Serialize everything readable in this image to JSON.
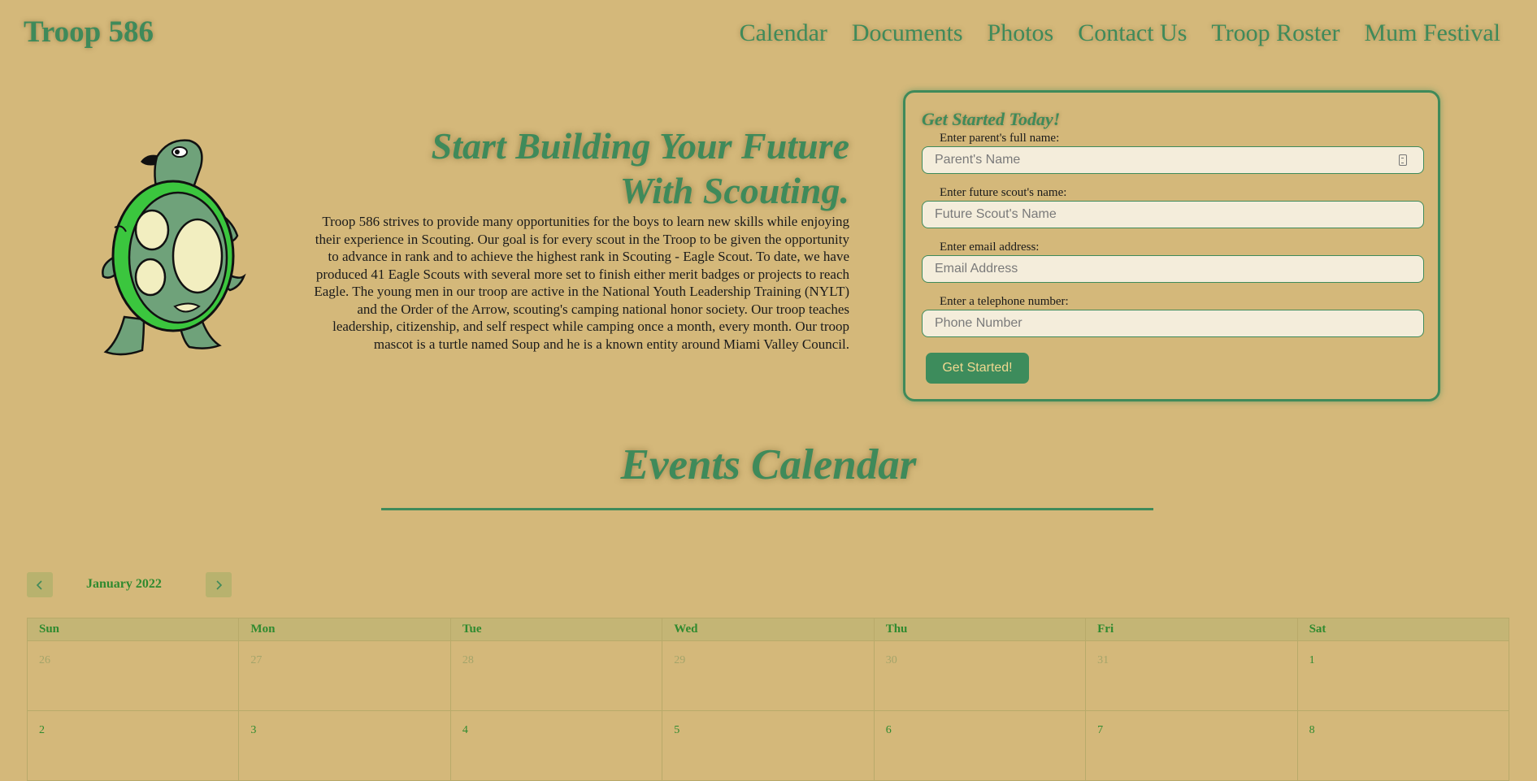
{
  "brand": "Troop 586",
  "nav": [
    "Calendar",
    "Documents",
    "Photos",
    "Contact Us",
    "Troop Roster",
    "Mum Festival"
  ],
  "hero": {
    "title": "Start Building Your Future With Scouting.",
    "body": "Troop 586 strives to provide many opportunities for the boys to learn new skills while enjoying their experience in Scouting. Our goal is for every scout in the Troop to be given the opportunity to advance in rank and to achieve the highest rank in Scouting - Eagle Scout. To date, we have produced 41 Eagle Scouts with several more set to finish either merit badges or projects to reach Eagle. The young men in our troop are active in the National Youth Leadership Training (NYLT) and the Order of the Arrow, scouting's camping national honor society. Our troop teaches leadership, citizenship, and self respect while camping once a month, every month. Our troop mascot is a turtle named Soup and he is a known entity around Miami Valley Council."
  },
  "signup": {
    "title": "Get Started Today!",
    "fields": [
      {
        "label": "Enter parent's full name:",
        "placeholder": "Parent's Name"
      },
      {
        "label": "Enter future scout's name:",
        "placeholder": "Future Scout's Name"
      },
      {
        "label": "Enter email address:",
        "placeholder": "Email Address"
      },
      {
        "label": "Enter a telephone number:",
        "placeholder": "Phone Number"
      }
    ],
    "submit": "Get Started!"
  },
  "events": {
    "title": "Events Calendar",
    "month": "January 2022",
    "weekdays": [
      "Sun",
      "Mon",
      "Tue",
      "Wed",
      "Thu",
      "Fri",
      "Sat"
    ],
    "weeks": [
      [
        {
          "d": "26",
          "muted": true
        },
        {
          "d": "27",
          "muted": true
        },
        {
          "d": "28",
          "muted": true
        },
        {
          "d": "29",
          "muted": true
        },
        {
          "d": "30",
          "muted": true
        },
        {
          "d": "31",
          "muted": true
        },
        {
          "d": "1",
          "muted": false
        }
      ],
      [
        {
          "d": "2",
          "muted": false
        },
        {
          "d": "3",
          "muted": false
        },
        {
          "d": "4",
          "muted": false
        },
        {
          "d": "5",
          "muted": false
        },
        {
          "d": "6",
          "muted": false
        },
        {
          "d": "7",
          "muted": false
        },
        {
          "d": "8",
          "muted": false
        }
      ]
    ]
  },
  "colors": {
    "background": "#d4b87a",
    "accent": "#3f8a5a",
    "calendar_text": "#2f8a2f"
  }
}
